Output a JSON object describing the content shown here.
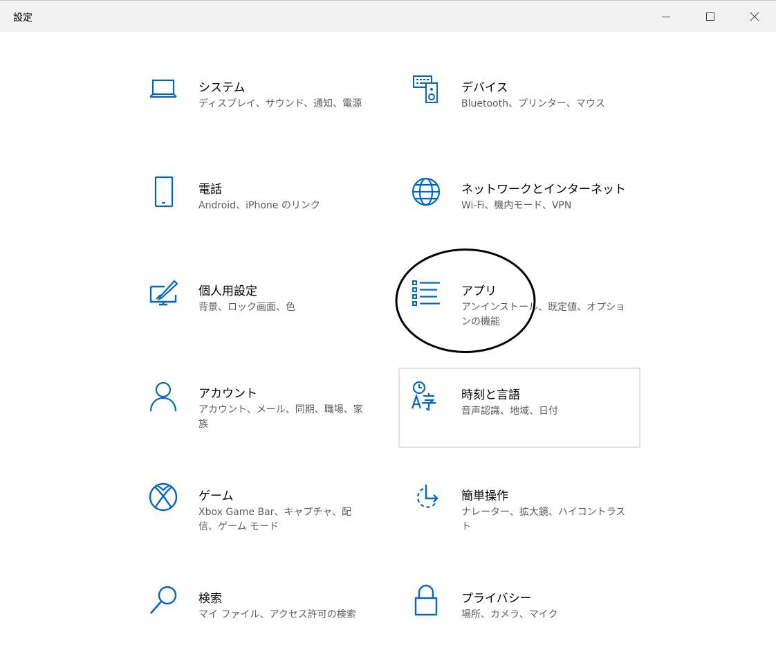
{
  "window": {
    "title": "設定"
  },
  "tiles": [
    {
      "name": "システム",
      "desc": "ディスプレイ、サウンド、通知、電源",
      "icon": "laptop-icon"
    },
    {
      "name": "デバイス",
      "desc": "Bluetooth、プリンター、マウス",
      "icon": "devices-icon"
    },
    {
      "name": "電話",
      "desc": "Android、iPhone のリンク",
      "icon": "phone-icon"
    },
    {
      "name": "ネットワークとインターネット",
      "desc": "Wi-Fi、機内モード、VPN",
      "icon": "globe-icon"
    },
    {
      "name": "個人用設定",
      "desc": "背景、ロック画面、色",
      "icon": "personalization-icon"
    },
    {
      "name": "アプリ",
      "desc": "アンインストール、既定値、オプションの機能",
      "icon": "apps-list-icon"
    },
    {
      "name": "アカウント",
      "desc": "アカウント、メール、同期、職場、家族",
      "icon": "person-icon"
    },
    {
      "name": "時刻と言語",
      "desc": "音声認識、地域、日付",
      "icon": "time-language-icon"
    },
    {
      "name": "ゲーム",
      "desc": "Xbox Game Bar、キャプチャ、配信、ゲーム モード",
      "icon": "xbox-icon"
    },
    {
      "name": "簡単操作",
      "desc": "ナレーター、拡大鏡、ハイコントラスト",
      "icon": "ease-of-access-icon"
    },
    {
      "name": "検索",
      "desc": "マイ ファイル、アクセス許可の検索",
      "icon": "search-icon"
    },
    {
      "name": "プライバシー",
      "desc": "場所、カメラ、マイク",
      "icon": "lock-icon"
    }
  ],
  "colors": {
    "accent": "#0067c0",
    "titlebar_bg": "#f2f2f2",
    "desc_text": "#5d5d5d",
    "focus_border": "#e3e3e3"
  }
}
